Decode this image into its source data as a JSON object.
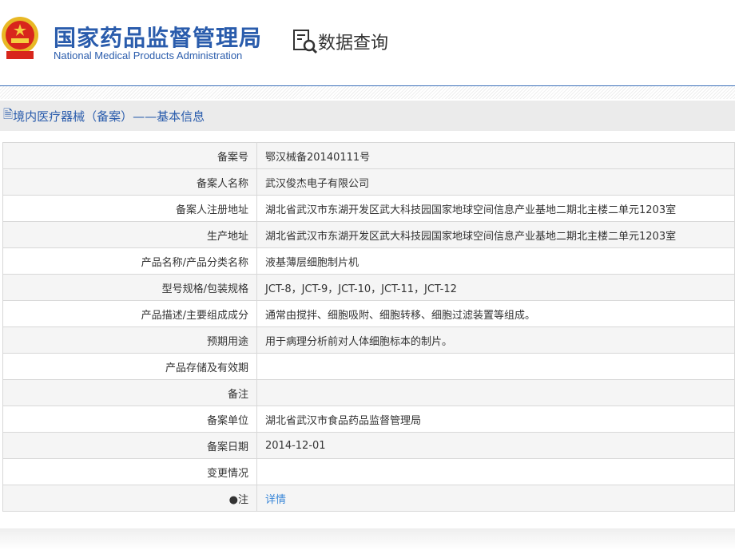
{
  "header": {
    "logo_cn": "国家药品监督管理局",
    "logo_en": "National Medical Products Administration",
    "query_label": "数据查询"
  },
  "section_title": "境内医疗器械（备案）——基本信息",
  "rows": [
    {
      "label": "备案号",
      "value": "鄂汉械备20140111号"
    },
    {
      "label": "备案人名称",
      "value": "武汉俊杰电子有限公司"
    },
    {
      "label": "备案人注册地址",
      "value": "湖北省武汉市东湖开发区武大科技园国家地球空间信息产业基地二期北主楼二单元1203室"
    },
    {
      "label": "生产地址",
      "value": "湖北省武汉市东湖开发区武大科技园国家地球空间信息产业基地二期北主楼二单元1203室"
    },
    {
      "label": "产品名称/产品分类名称",
      "value": "液基薄层细胞制片机"
    },
    {
      "label": "型号规格/包装规格",
      "value": "JCT-8，JCT-9，JCT-10，JCT-11，JCT-12"
    },
    {
      "label": "产品描述/主要组成成分",
      "value": "通常由搅拌、细胞吸附、细胞转移、细胞过滤装置等组成。"
    },
    {
      "label": "预期用途",
      "value": "用于病理分析前对人体细胞标本的制片。"
    },
    {
      "label": "产品存储及有效期",
      "value": ""
    },
    {
      "label": "备注",
      "value": ""
    },
    {
      "label": "备案单位",
      "value": "湖北省武汉市食品药品监督管理局"
    },
    {
      "label": "备案日期",
      "value": "2014-12-01"
    },
    {
      "label": "变更情况",
      "value": ""
    }
  ],
  "note": {
    "label": "注",
    "link": "详情"
  }
}
